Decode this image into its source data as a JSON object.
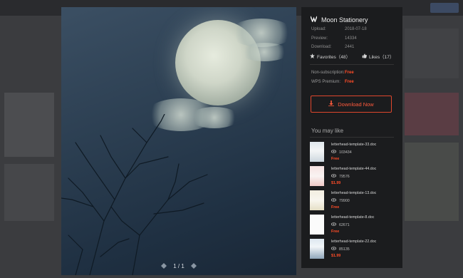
{
  "viewer": {
    "pager": "1 / 1"
  },
  "panel": {
    "title": "Moon Stationery",
    "meta": [
      {
        "label": "Upload:",
        "value": "2018-07-18"
      },
      {
        "label": "Preview:",
        "value": "14334"
      },
      {
        "label": "Download:",
        "value": "2441"
      }
    ],
    "favorites": "Favorites（48）",
    "likes": "Likes（17）",
    "plans": [
      {
        "label": "Non-subscription:",
        "value": "Free"
      },
      {
        "label": "WPS Premium:",
        "value": "Free"
      }
    ],
    "download_label": "Download Now",
    "may_like_title": "You may like",
    "items": [
      {
        "name": "letterhead-template-33.doc",
        "views": "103434",
        "price": "Free"
      },
      {
        "name": "letterhead-template-44.doc",
        "views": "79576",
        "price": "$1.99"
      },
      {
        "name": "letterhead-template-13.doc",
        "views": "79900",
        "price": "Free"
      },
      {
        "name": "letterhead-template-8.doc",
        "views": "62671",
        "price": "Free"
      },
      {
        "name": "letterhead-template-22.doc",
        "views": "85135",
        "price": "$1.99"
      }
    ]
  },
  "colors": {
    "accent": "#ff4d28",
    "panel_bg": "#1b1c1e"
  }
}
